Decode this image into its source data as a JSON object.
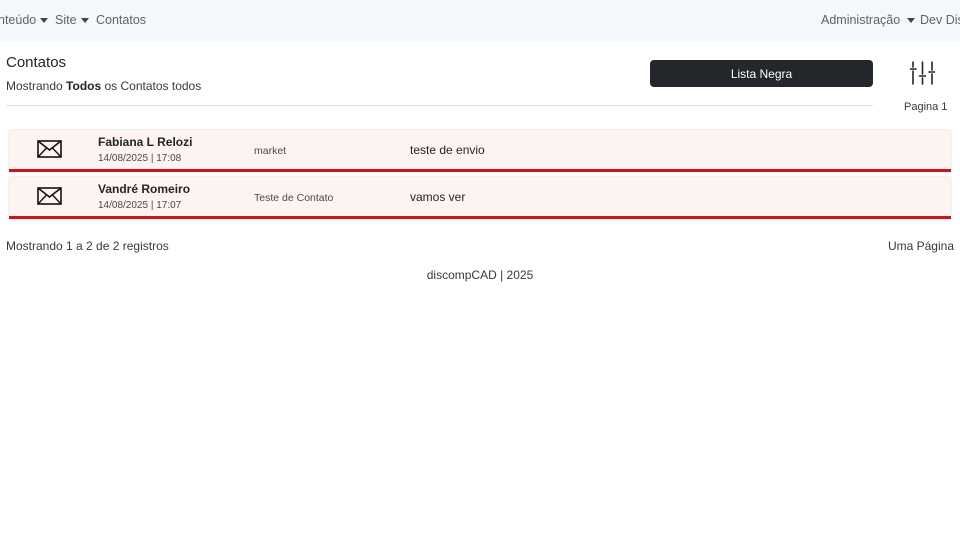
{
  "navbar": {
    "left": [
      {
        "label": "nteúdo",
        "dropdown": true
      },
      {
        "label": "Site",
        "dropdown": true
      },
      {
        "label": "Contatos",
        "dropdown": false
      }
    ],
    "right": [
      {
        "label": "Administração",
        "dropdown": true
      },
      {
        "label": "Dev Dis",
        "dropdown": false
      }
    ]
  },
  "header": {
    "title": "Contatos",
    "subtitle_prefix": "Mostrando",
    "subtitle_bold": "Todos",
    "subtitle_suffix": "os Contatos todos",
    "blacklist_button": "Lista Negra",
    "page_label": "Pagina 1",
    "filter_icon": "sliders-icon"
  },
  "contacts": [
    {
      "name": "Fabiana L Relozi",
      "datetime": "14/08/2025 | 17:08",
      "subject": "market",
      "message": "teste de envio",
      "icon": "envelope-icon"
    },
    {
      "name": "Vandré Romeiro",
      "datetime": "14/08/2025 | 17:07",
      "subject": "Teste de Contato",
      "message": "vamos ver",
      "icon": "envelope-icon"
    }
  ],
  "footer": {
    "records": "Mostrando 1 a 2 de 2 registros",
    "pagination": "Uma Página",
    "copyright": "discompCAD | 2025"
  },
  "colors": {
    "navbar_bg": "#f5f8fb",
    "row_bg": "#fdf3f1",
    "row_border": "#c8141c",
    "button_bg": "#23272b"
  }
}
